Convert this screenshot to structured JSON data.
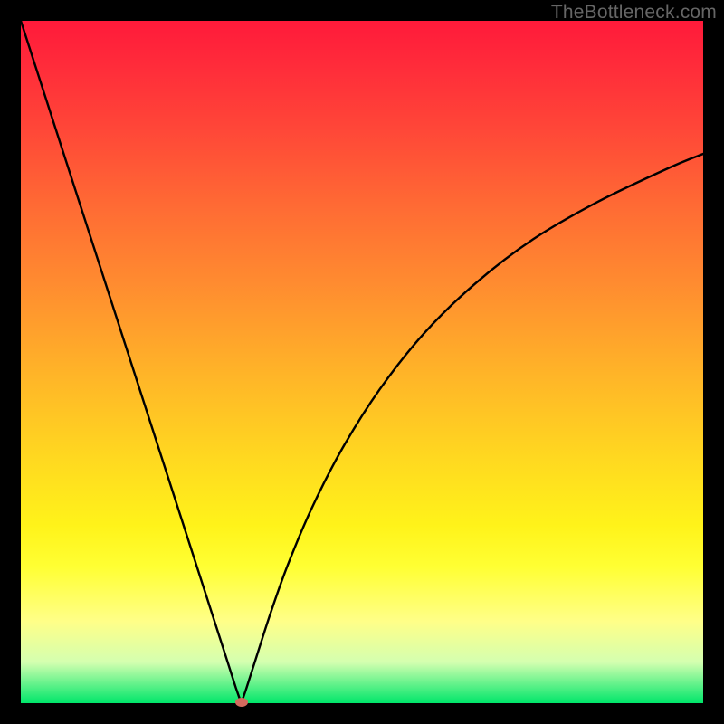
{
  "watermark": "TheBottleneck.com",
  "marker_color": "#d36a5e",
  "curve_color": "#000000",
  "curve_stroke_width": 2.4,
  "plot": {
    "inner_left": 23,
    "inner_top": 23,
    "inner_width": 754,
    "inner_height": 754
  },
  "chart_data": {
    "type": "line",
    "title": "",
    "xlabel": "",
    "ylabel": "",
    "xlim": [
      0,
      100
    ],
    "ylim": [
      0,
      100
    ],
    "series": [
      {
        "name": "left-branch",
        "x": [
          0,
          5,
          10,
          15,
          20,
          25,
          28,
          30,
          31.5,
          32.3
        ],
        "values": [
          100,
          84.5,
          69,
          53.5,
          38,
          22.5,
          13.2,
          7,
          2.3,
          0
        ]
      },
      {
        "name": "right-branch",
        "x": [
          32.3,
          33.1,
          34.6,
          36.6,
          39.1,
          42.6,
          47.1,
          52.6,
          59.1,
          66.6,
          75.1,
          84.6,
          95.1,
          100
        ],
        "values": [
          0,
          2.3,
          7,
          13.2,
          20.2,
          28.5,
          37.3,
          46,
          54.2,
          61.5,
          68,
          73.5,
          78.5,
          80.5
        ]
      }
    ],
    "annotations": [
      {
        "name": "minimum-marker",
        "x": 32.3,
        "y": 0
      }
    ],
    "grid": false,
    "legend": false
  }
}
